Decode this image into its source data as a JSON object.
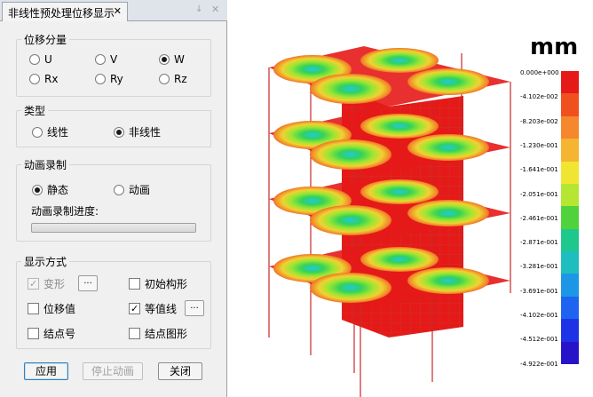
{
  "tab": {
    "title": "非线性预处理位移显示",
    "close": "✕",
    "pin": "↓",
    "close2": "✕"
  },
  "component_group": {
    "title": "位移分量",
    "options": [
      {
        "label": "U",
        "checked": false
      },
      {
        "label": "V",
        "checked": false
      },
      {
        "label": "W",
        "checked": true
      },
      {
        "label": "Rx",
        "checked": false
      },
      {
        "label": "Ry",
        "checked": false
      },
      {
        "label": "Rz",
        "checked": false
      }
    ]
  },
  "type_group": {
    "title": "类型",
    "options": [
      {
        "label": "线性",
        "checked": false
      },
      {
        "label": "非线性",
        "checked": true
      }
    ]
  },
  "anim_group": {
    "title": "动画录制",
    "options": [
      {
        "label": "静态",
        "checked": true
      },
      {
        "label": "动画",
        "checked": false
      }
    ],
    "progress_label": "动画录制进度:",
    "progress": 0
  },
  "display_group": {
    "title": "显示方式",
    "deform": {
      "label": "变形",
      "checked": true,
      "disabled": true
    },
    "initial": {
      "label": "初始构形",
      "checked": false
    },
    "disp_value": {
      "label": "位移值",
      "checked": false
    },
    "contour": {
      "label": "等值线",
      "checked": true
    },
    "node_id": {
      "label": "结点号",
      "checked": false
    },
    "node_shape": {
      "label": "结点图形",
      "checked": false
    },
    "dots": "..."
  },
  "buttons": {
    "apply": "应用",
    "stop": "停止动画",
    "close": "关闭"
  },
  "viewport": {
    "unit": "mm",
    "legend_labels": [
      "0.000e+000",
      "-4.102e-002",
      "-8.203e-002",
      "-1.230e-001",
      "-1.641e-001",
      "-2.051e-001",
      "-2.461e-001",
      "-2.871e-001",
      "-3.281e-001",
      "-3.691e-001",
      "-4.102e-001",
      "-4.512e-001",
      "-4.922e-001"
    ],
    "legend_colors": [
      "#e61919",
      "#f0501e",
      "#f5872d",
      "#f5b432",
      "#f0e632",
      "#b4e632",
      "#50d23c",
      "#1ec88c",
      "#1ebebe",
      "#1e96e6",
      "#1e64f0",
      "#1e32e6",
      "#2814c8"
    ]
  }
}
